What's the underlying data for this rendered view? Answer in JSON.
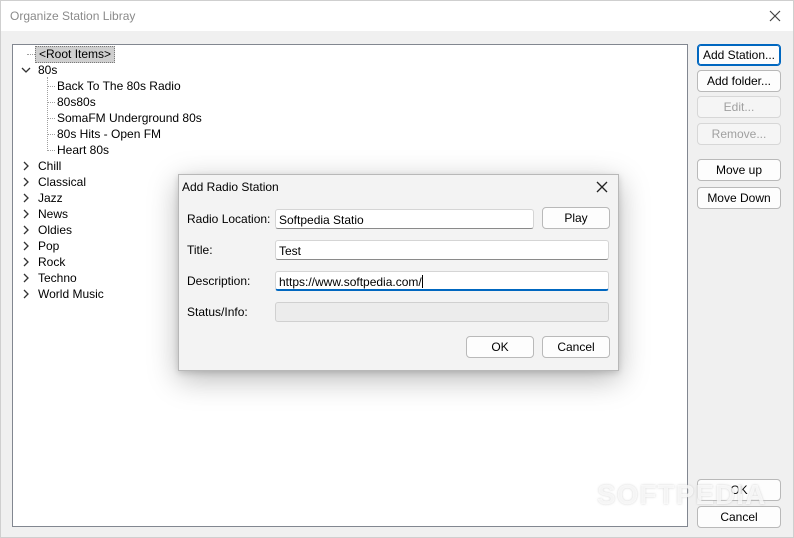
{
  "window": {
    "title": "Organize Station Libray"
  },
  "tree": {
    "root_label": "<Root Items>",
    "expanded_group": {
      "label": "80s",
      "children": [
        "Back To The 80s Radio",
        "80s80s",
        "SomaFM Underground 80s",
        "80s Hits - Open FM",
        "Heart 80s"
      ]
    },
    "collapsed_groups": [
      "Chill",
      "Classical",
      "Jazz",
      "News",
      "Oldies",
      "Pop",
      "Rock",
      "Techno",
      "World Music"
    ]
  },
  "side_buttons": {
    "add_station": "Add Station...",
    "add_folder": "Add folder...",
    "edit": "Edit...",
    "remove": "Remove...",
    "move_up": "Move up",
    "move_down": "Move Down"
  },
  "footer_buttons": {
    "ok": "OK",
    "cancel": "Cancel"
  },
  "dialog": {
    "title": "Add Radio Station",
    "labels": {
      "radio_location": "Radio Location:",
      "title": "Title:",
      "description": "Description:",
      "status": "Status/Info:"
    },
    "values": {
      "radio_location": "Softpedia Statio",
      "title": "Test",
      "description": "https://www.softpedia.com/",
      "status": ""
    },
    "play_label": "Play",
    "ok_label": "OK",
    "cancel_label": "Cancel"
  },
  "watermark": "SOFTPEDIA",
  "colors": {
    "accent": "#0067c0",
    "selection": "#cfcfcf"
  }
}
